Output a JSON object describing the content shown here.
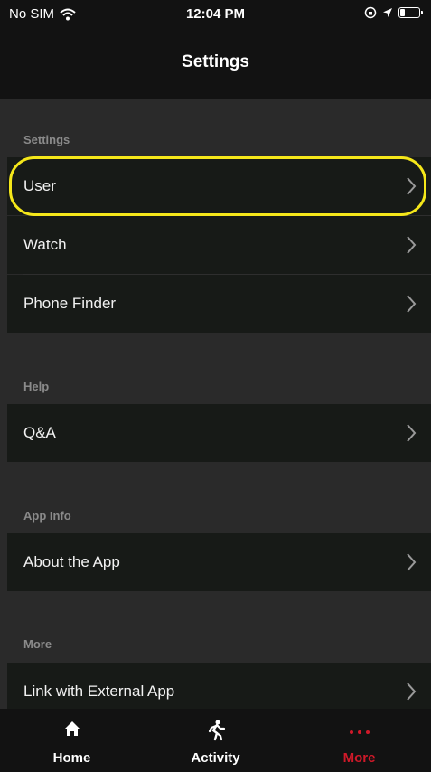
{
  "status_bar": {
    "carrier": "No SIM",
    "time": "12:04 PM",
    "icons": [
      "wifi-icon",
      "orientation-lock-icon",
      "location-arrow-icon",
      "battery-icon"
    ]
  },
  "nav": {
    "title": "Settings"
  },
  "sections": [
    {
      "header": "Settings",
      "items": [
        {
          "label": "User"
        },
        {
          "label": "Watch"
        },
        {
          "label": "Phone Finder"
        }
      ]
    },
    {
      "header": "Help",
      "items": [
        {
          "label": "Q&A"
        }
      ]
    },
    {
      "header": "App Info",
      "items": [
        {
          "label": "About the App"
        }
      ]
    },
    {
      "header": "More",
      "items": [
        {
          "label": "Link with External App"
        }
      ]
    }
  ],
  "tabs": [
    {
      "label": "Home",
      "icon": "home-icon",
      "active": false
    },
    {
      "label": "Activity",
      "icon": "running-person-icon",
      "active": false
    },
    {
      "label": "More",
      "icon": "more-dots-icon",
      "active": true
    }
  ],
  "colors": {
    "highlight": "#f5e71a",
    "active_tab": "#d01929",
    "background": "#2a2a2a",
    "row": "#171a17"
  }
}
